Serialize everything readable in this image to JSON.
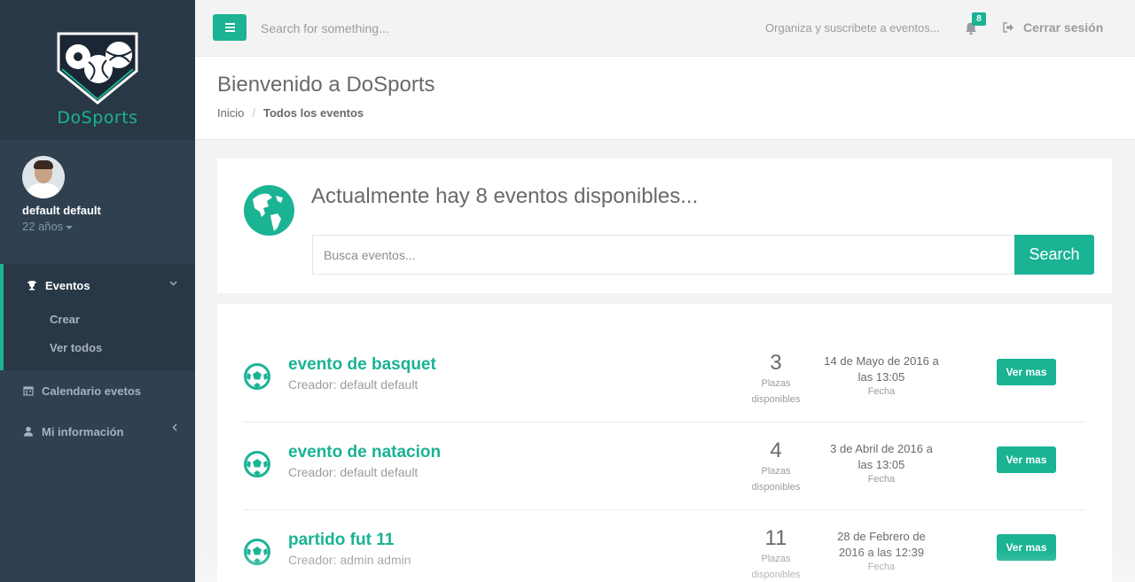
{
  "colors": {
    "accent": "#1ab394",
    "sidebar_bg": "#2f4050",
    "sidebar_dark": "#293846",
    "page_bg": "#f3f3f4"
  },
  "brand": {
    "name": "DoSports",
    "logo_icon": "sports-balls-shield-icon"
  },
  "profile": {
    "name": "default default",
    "age": "22 años"
  },
  "sidebar": {
    "active_section": {
      "label": "Eventos",
      "icon": "trophy-icon",
      "subitems": [
        {
          "label": "Crear"
        },
        {
          "label": "Ver todos"
        }
      ]
    },
    "items": [
      {
        "label": "Calendario evetos",
        "icon": "calendar-icon"
      },
      {
        "label": "Mi información",
        "icon": "user-icon"
      }
    ]
  },
  "topbar": {
    "search_placeholder": "Search for something...",
    "welcome_message": "Organiza y suscribete a eventos...",
    "notifications_count": "8",
    "logout_label": "Cerrar sesión"
  },
  "page": {
    "title": "Bienvenido a DoSports",
    "breadcrumb": {
      "home": "Inicio",
      "current": "Todos los eventos"
    }
  },
  "search_panel": {
    "title": "Actualmente hay 8 eventos disponibles...",
    "placeholder": "Busca eventos...",
    "button_label": "Search"
  },
  "events": [
    {
      "title": "evento de basquet",
      "creator": "Creador: default default",
      "spots": "3",
      "spots_label_1": "Plazas",
      "spots_label_2": "disponibles",
      "date_line1": "14 de Mayo de 2016 a",
      "date_line2": "las 13:05",
      "date_label": "Fecha",
      "button": "Ver mas"
    },
    {
      "title": "evento de natacion",
      "creator": "Creador: default default",
      "spots": "4",
      "spots_label_1": "Plazas",
      "spots_label_2": "disponibles",
      "date_line1": "3 de Abril de 2016 a",
      "date_line2": "las 13:05",
      "date_label": "Fecha",
      "button": "Ver mas"
    },
    {
      "title": "partido fut 11",
      "creator": "Creador: admin admin",
      "spots": "11",
      "spots_label_1": "Plazas",
      "spots_label_2": "disponibles",
      "date_line1": "28 de Febrero de",
      "date_line2": "2016 a las 12:39",
      "date_label": "Fecha",
      "button": "Ver mas"
    }
  ]
}
